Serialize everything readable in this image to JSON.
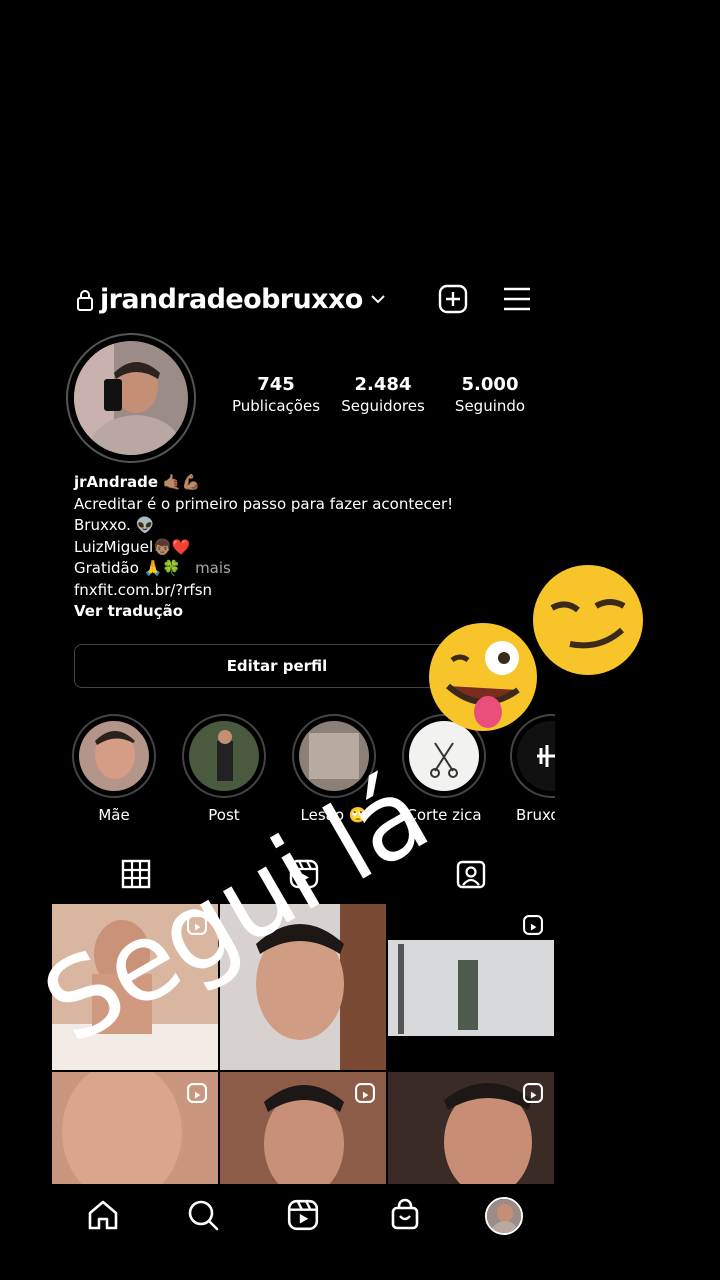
{
  "header": {
    "username": "jrandradeobruxxo"
  },
  "stats": [
    {
      "value": "745",
      "label": "Publicações"
    },
    {
      "value": "2.484",
      "label": "Seguidores"
    },
    {
      "value": "5.000",
      "label": "Seguindo"
    }
  ],
  "bio": {
    "name": "jrAndrade",
    "line1": "Acreditar é o primeiro passo para fazer acontecer!",
    "line2": "Bruxxo.",
    "line3": "LuizMiguel",
    "line4": "Gratidão",
    "more": "mais",
    "link": "fnxfit.com.br/?rfsn",
    "translate": "Ver tradução"
  },
  "edit_profile_label": "Editar perfil",
  "highlights": [
    {
      "label": "Mãe"
    },
    {
      "label": "Post"
    },
    {
      "label": "Lesão 🙄"
    },
    {
      "label": "Corte zica"
    },
    {
      "label": "Bruxo"
    }
  ],
  "overlay": {
    "text": "Segui lá"
  },
  "colors": {
    "background": "#000000",
    "text": "#ffffff",
    "muted": "#a8a8a8",
    "border": "#444444"
  }
}
